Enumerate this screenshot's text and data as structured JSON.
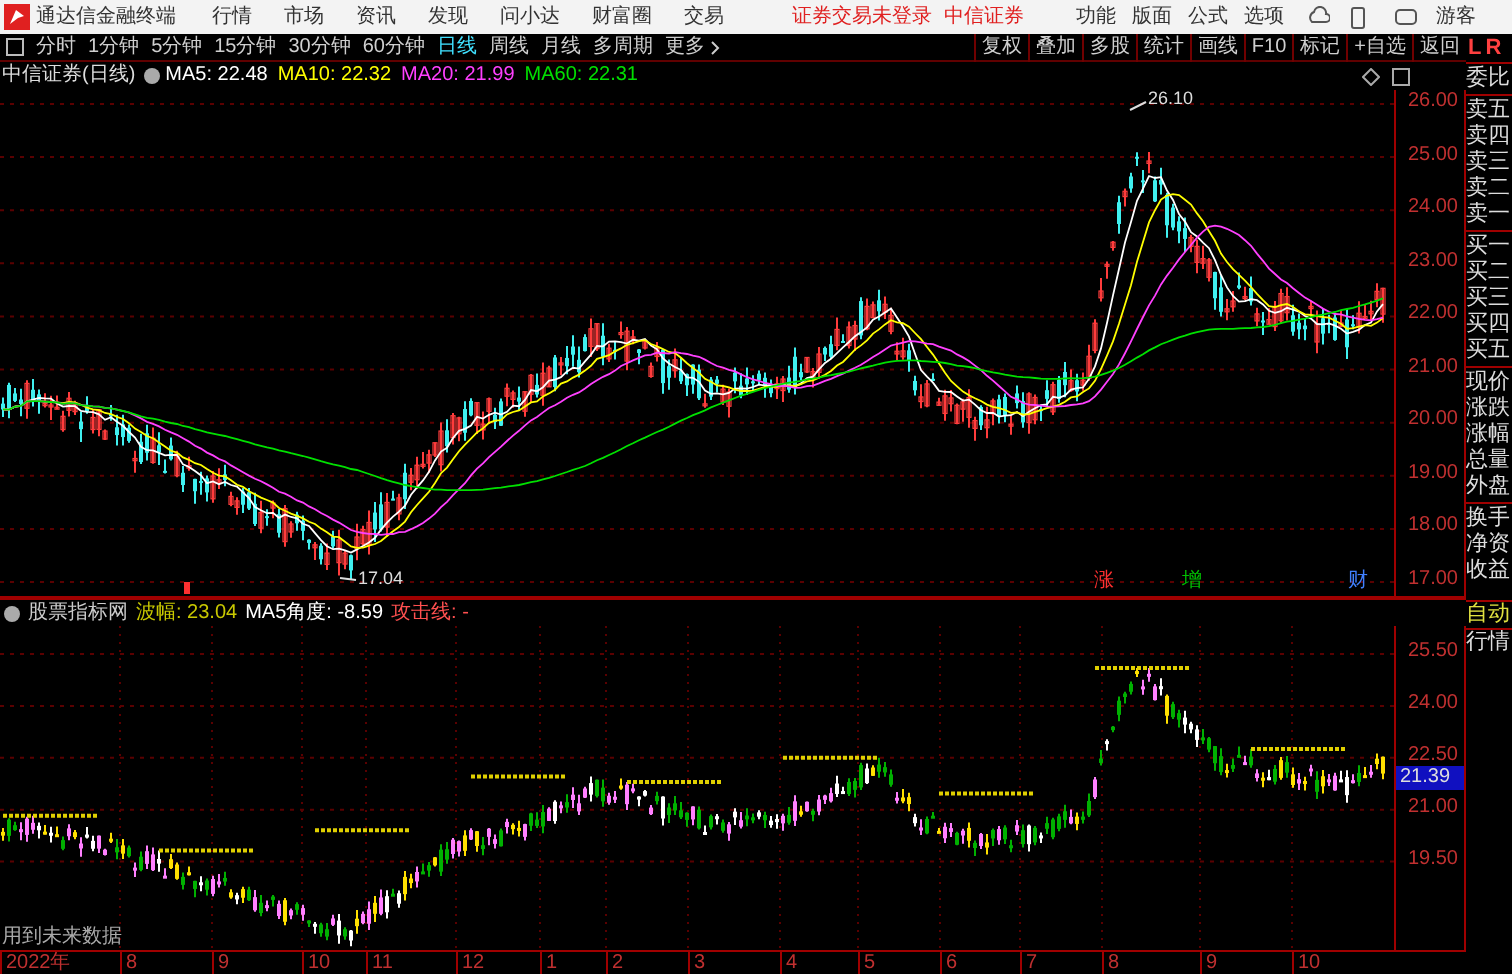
{
  "app": {
    "title": "通达信金融终端",
    "menu": [
      "行情",
      "市场",
      "资讯",
      "发现",
      "问小达",
      "财富圈",
      "交易"
    ],
    "login_status": "证券交易未登录",
    "broker": "中信证券",
    "tools": [
      "功能",
      "版面",
      "公式",
      "选项"
    ],
    "user": "游客"
  },
  "periods": [
    {
      "label": "分时",
      "selected": false
    },
    {
      "label": "1分钟",
      "selected": false
    },
    {
      "label": "5分钟",
      "selected": false
    },
    {
      "label": "15分钟",
      "selected": false
    },
    {
      "label": "30分钟",
      "selected": false
    },
    {
      "label": "60分钟",
      "selected": false
    },
    {
      "label": "日线",
      "selected": true
    },
    {
      "label": "周线",
      "selected": false
    },
    {
      "label": "月线",
      "selected": false
    },
    {
      "label": "多周期",
      "selected": false
    }
  ],
  "more": "更多",
  "actions": [
    "复权",
    "叠加",
    "多股",
    "统计",
    "画线",
    "F10",
    "标记",
    "+自选",
    "返回"
  ],
  "side_tabs": [
    {
      "label": "L",
      "color": "#ff4040"
    },
    {
      "label": "R",
      "color": "#ff4040"
    }
  ],
  "main_chart": {
    "title": "中信证券(日线)",
    "mas": [
      {
        "label": "MA5: 22.48",
        "color": "#ffffff"
      },
      {
        "label": "MA10: 22.32",
        "color": "#ffff00"
      },
      {
        "label": "MA20: 21.99",
        "color": "#ff40ff"
      },
      {
        "label": "MA60: 22.31",
        "color": "#00e000"
      }
    ],
    "y_ticks": [
      "26.00",
      "25.00",
      "24.00",
      "23.00",
      "22.00",
      "21.00",
      "20.00",
      "19.00",
      "18.00",
      "17.00"
    ],
    "high_label": "26.10",
    "low_label": "17.04",
    "event_markers": [
      {
        "label": "涨",
        "color": "#ff3030"
      },
      {
        "label": "增",
        "color": "#00c000"
      },
      {
        "label": "财",
        "color": "#4080ff"
      }
    ]
  },
  "quote_fields": [
    [
      "委比"
    ],
    [
      "卖五",
      "卖四",
      "卖三",
      "卖二",
      "卖一"
    ],
    [
      "买一",
      "买二",
      "买三",
      "买四",
      "买五"
    ],
    [
      "现价",
      "涨跌",
      "涨幅",
      "总量",
      "外盘"
    ],
    [
      "换手",
      "净资",
      "收益"
    ]
  ],
  "side_buttons": [
    "自动",
    "行情"
  ],
  "indicator": {
    "name": "股票指标网",
    "values": [
      {
        "label": "波幅: 23.04",
        "color": "#c8c800"
      },
      {
        "label": "MA5角度: -8.59",
        "color": "#ffffff"
      },
      {
        "label": "攻击线: -",
        "color": "#ff5050"
      }
    ],
    "y_ticks": [
      "25.50",
      "24.00",
      "22.50",
      "21.00",
      "19.50"
    ],
    "current": "21.39",
    "note": "用到未来数据"
  },
  "date_axis": [
    "2022年",
    "8",
    "9",
    "10",
    "11",
    "12",
    "1",
    "2",
    "3",
    "4",
    "5",
    "6",
    "7",
    "8",
    "9",
    "10"
  ]
}
